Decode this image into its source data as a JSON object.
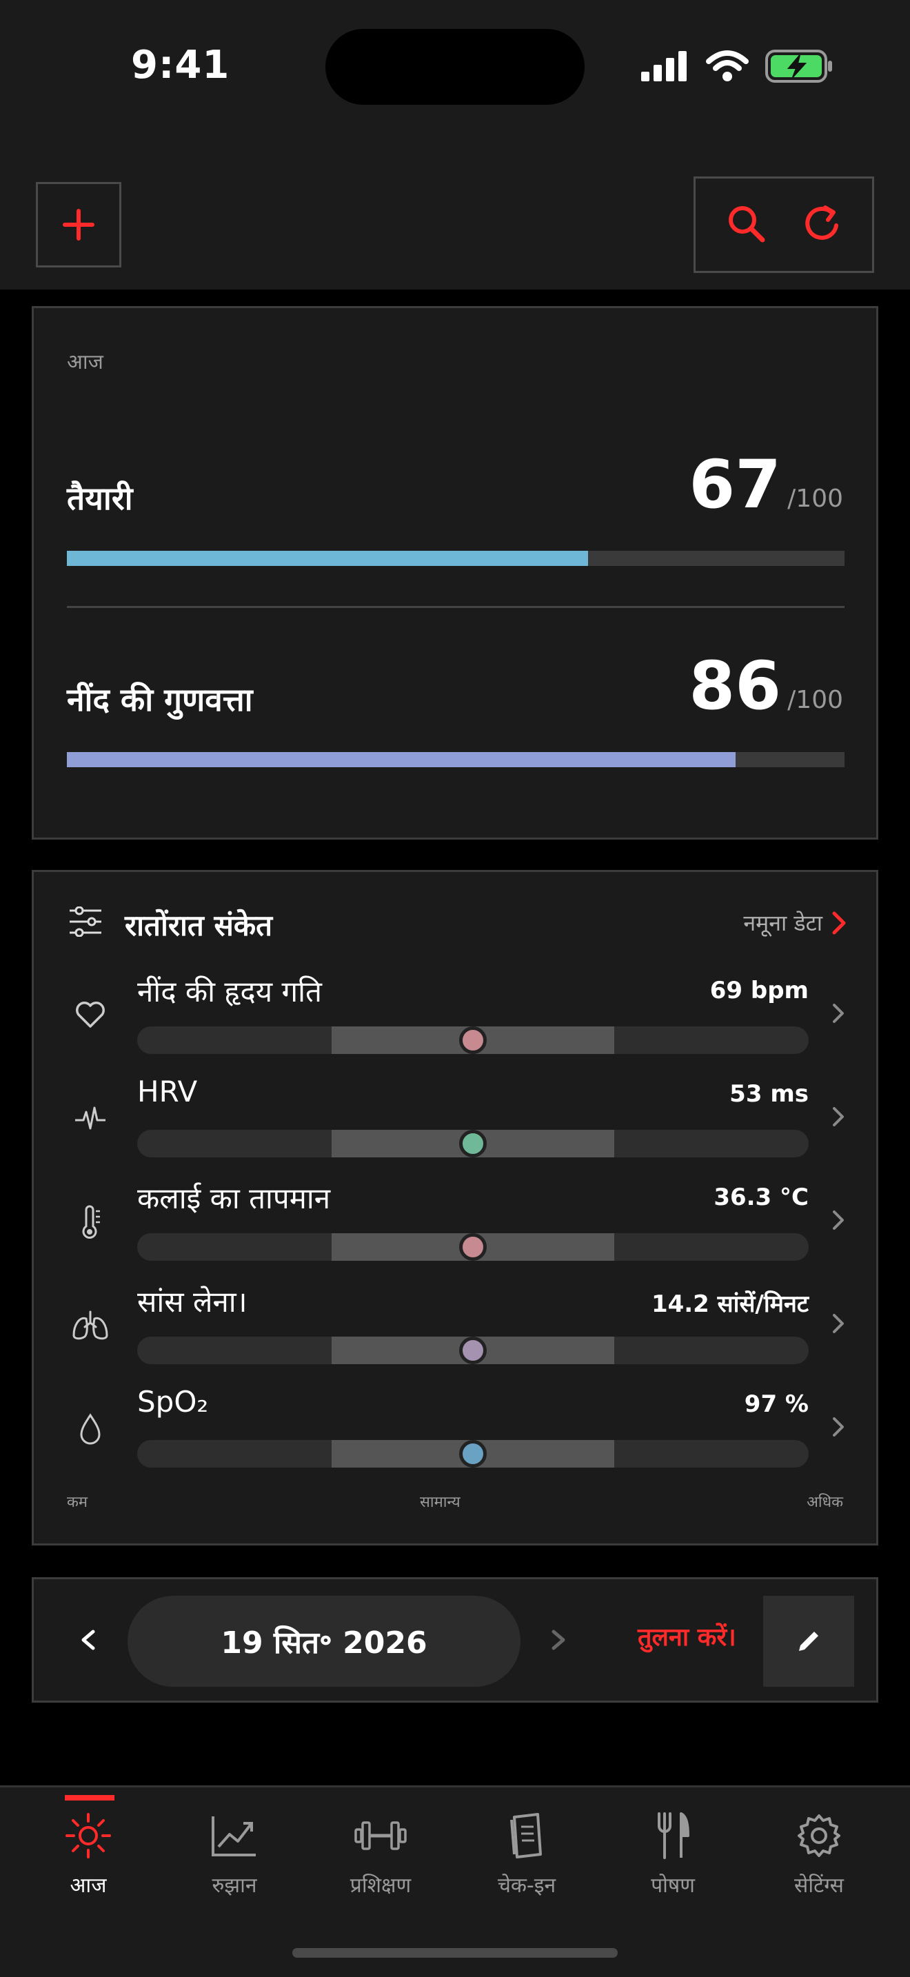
{
  "status_bar": {
    "time": "9:41"
  },
  "top_bar": {},
  "today": {
    "label": "आज",
    "readiness": {
      "name": "तैयारी",
      "value": "67",
      "suffix": "/100",
      "fraction": 0.67,
      "color": "#6fb7d6"
    },
    "sleep_quality": {
      "name": "नींद की गुणवत्ता",
      "value": "86",
      "suffix": "/100",
      "fraction": 0.86,
      "color": "#8f9ed6"
    }
  },
  "signals": {
    "title": "रातोंरात संकेत",
    "sample_label": "नमूना डेटा",
    "items": [
      {
        "name": "नींद की हृदय गति",
        "value": "69 bpm",
        "icon": "heart-icon",
        "dot_color": "#c78a90"
      },
      {
        "name": "HRV",
        "value": "53 ms",
        "icon": "pulse-icon",
        "dot_color": "#6fb898"
      },
      {
        "name": "कलाई का तापमान",
        "value": "36.3 °C",
        "icon": "thermometer-icon",
        "dot_color": "#c78a90"
      },
      {
        "name": "सांस लेना।",
        "value": "14.2 सांसें/मिनट",
        "icon": "lungs-icon",
        "dot_color": "#a592b0"
      },
      {
        "name": "SpO₂",
        "value": "97 %",
        "icon": "drop-icon",
        "dot_color": "#6aa2c4"
      }
    ],
    "scale": {
      "low": "कम",
      "normal": "सामान्य",
      "high": "अधिक"
    }
  },
  "date_nav": {
    "date": "19 सित॰ 2026",
    "compare_label": "तुलना करें।"
  },
  "tabs": [
    {
      "label": "आज",
      "icon": "sun-icon",
      "active": true
    },
    {
      "label": "रुझान",
      "icon": "trend-icon",
      "active": false
    },
    {
      "label": "प्रशिक्षण",
      "icon": "dumbbell-icon",
      "active": false
    },
    {
      "label": "चेक-इन",
      "icon": "journal-icon",
      "active": false
    },
    {
      "label": "पोषण",
      "icon": "fork-knife-icon",
      "active": false
    },
    {
      "label": "सेटिंग्स",
      "icon": "gear-icon",
      "active": false
    }
  ],
  "colors": {
    "accent": "#ff2a2a",
    "card_bg": "#1b1b1b",
    "card_border": "#3c3c3c"
  }
}
